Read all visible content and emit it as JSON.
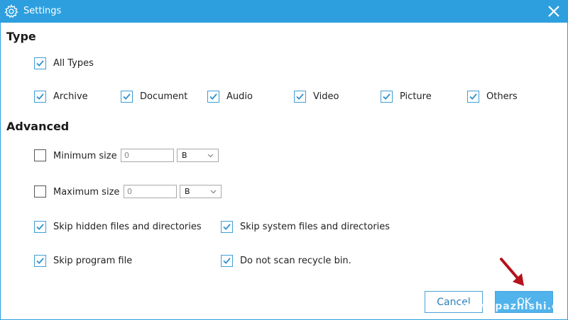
{
  "window": {
    "title": "Settings"
  },
  "type_section": {
    "title": "Type",
    "all_types": {
      "label": "All Types",
      "checked": true
    },
    "items": [
      {
        "label": "Archive",
        "checked": true
      },
      {
        "label": "Document",
        "checked": true
      },
      {
        "label": "Audio",
        "checked": true
      },
      {
        "label": "Video",
        "checked": true
      },
      {
        "label": "Picture",
        "checked": true
      },
      {
        "label": "Others",
        "checked": true
      }
    ]
  },
  "advanced_section": {
    "title": "Advanced",
    "min_size": {
      "label": "Minimum size",
      "checked": false,
      "value": "0",
      "unit": "B"
    },
    "max_size": {
      "label": "Maximum size",
      "checked": false,
      "value": "0",
      "unit": "B"
    },
    "skip_hidden": {
      "label": "Skip hidden files and directories",
      "checked": true
    },
    "skip_system": {
      "label": "Skip system files and directories",
      "checked": true
    },
    "skip_program": {
      "label": "Skip program file",
      "checked": true
    },
    "no_recycle": {
      "label": "Do not scan recycle bin.",
      "checked": true
    }
  },
  "buttons": {
    "cancel": "Cancel",
    "ok": "OK"
  },
  "watermark": "www.pazhishi.co",
  "colors": {
    "titlebar": "#2d9fde",
    "accent": "#3f9fd6",
    "ok_button": "#51b3ec",
    "arrow": "#b5121b"
  }
}
